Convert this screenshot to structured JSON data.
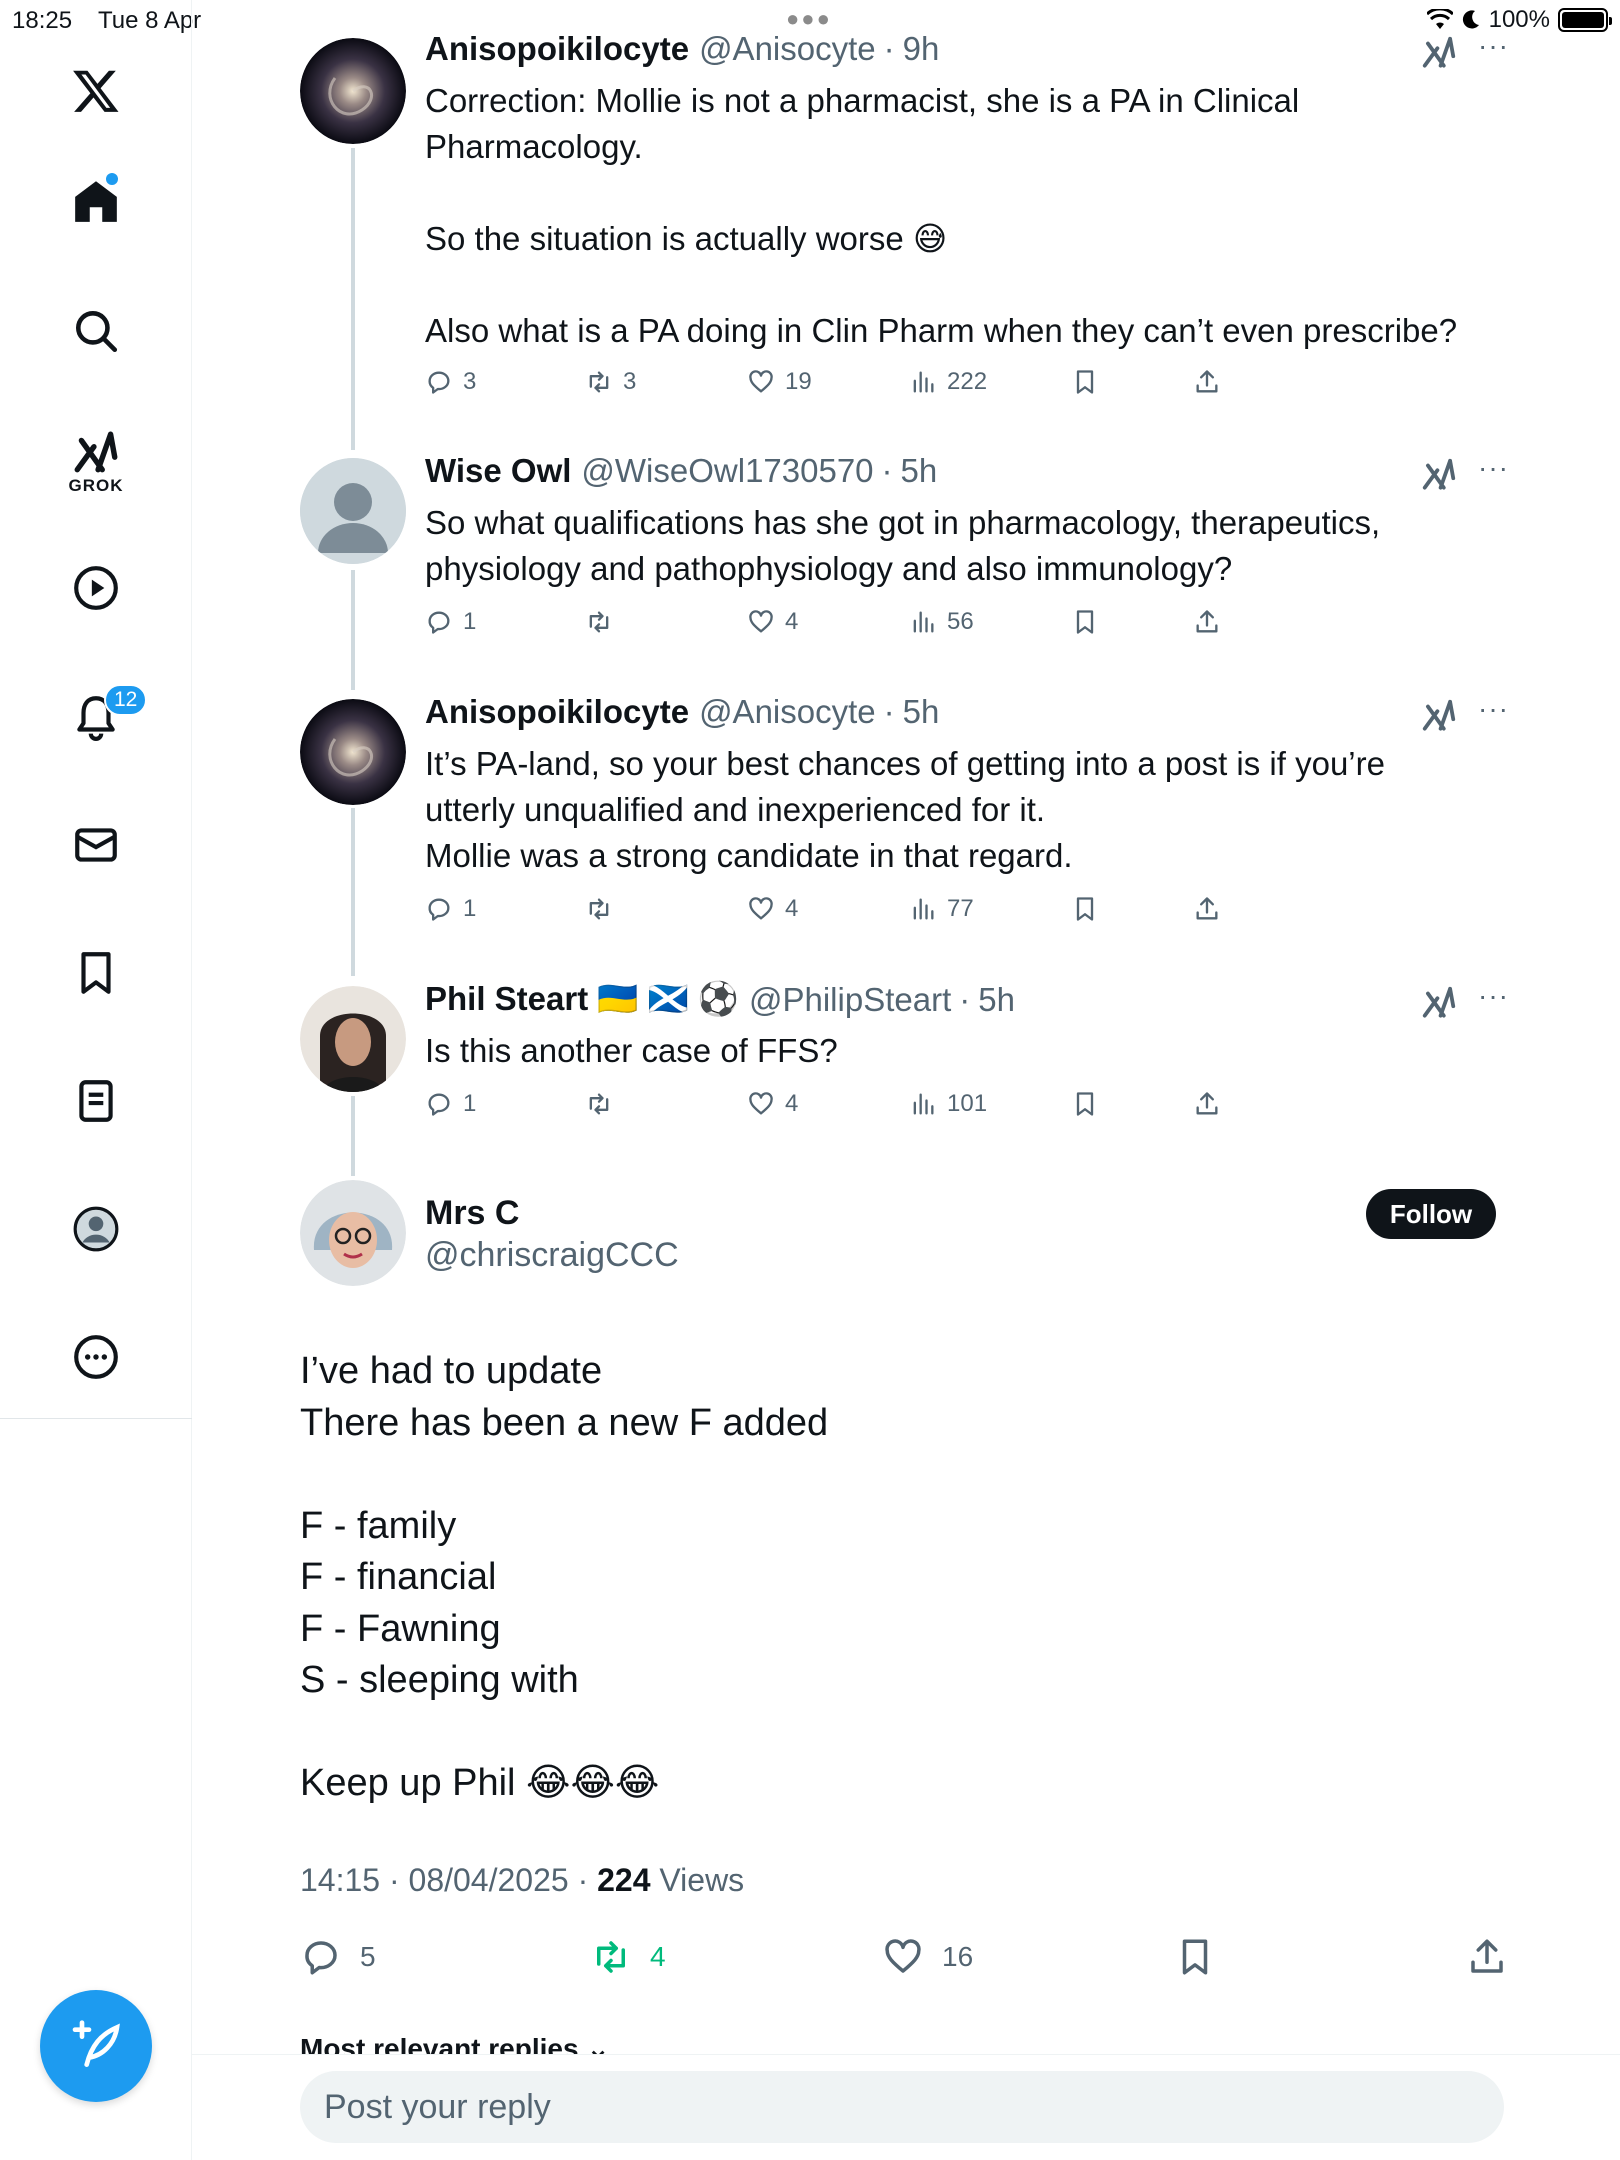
{
  "status_bar": {
    "time": "18:25",
    "date": "Tue 8 Apr",
    "battery": "100%"
  },
  "sidebar": {
    "grok_label": "GROK",
    "notifications_badge": "12",
    "items": [
      "x-logo",
      "home-icon",
      "search-icon",
      "grok-icon",
      "video-icon",
      "bell-icon",
      "mail-icon",
      "bookmark-icon",
      "list-icon",
      "profile-icon",
      "more-icon"
    ]
  },
  "replies": [
    {
      "name": "Anisopoikilocyte",
      "handle": "@Anisocyte",
      "time": "9h",
      "text": "Correction: Mollie is not a pharmacist, she is a PA in Clinical\nPharmacology.\n\nSo the situation is actually worse 😅\n\nAlso what is a PA doing in Clin Pharm when they can’t even prescribe?",
      "replies": "3",
      "reposts": "3",
      "likes": "19",
      "views": "222"
    },
    {
      "name": "Wise Owl",
      "handle": "@WiseOwl1730570",
      "time": "5h",
      "text": "So what qualifications has she got in pharmacology, therapeutics,\nphysiology and pathophysiology and also immunology?",
      "replies": "1",
      "reposts": "",
      "likes": "4",
      "views": "56"
    },
    {
      "name": "Anisopoikilocyte",
      "handle": "@Anisocyte",
      "time": "5h",
      "text": "It’s PA-land, so your best chances of getting into a post is if you’re\nutterly unqualified and inexperienced for it.\nMollie was a strong candidate in that regard.",
      "replies": "1",
      "reposts": "",
      "likes": "4",
      "views": "77"
    },
    {
      "name": "Phil Steart 🇺🇦 🏴󠁧󠁢󠁳󠁣󠁴󠁿 ⚽",
      "handle": "@PhilipSteart",
      "time": "5h",
      "text": "Is this another case of FFS?",
      "replies": "1",
      "reposts": "",
      "likes": "4",
      "views": "101"
    }
  ],
  "main_tweet": {
    "name": "Mrs C",
    "handle": "@chriscraigCCC",
    "follow_label": "Follow",
    "text": "I’ve had to update\nThere has been a new F added\n\nF - family\nF - financial\nF - Fawning\nS - sleeping with\n\nKeep up Phil 😂😂😂",
    "time": "14:15 · 08/04/2025 · ",
    "views_count": "224",
    "views_label": " Views",
    "replies": "5",
    "reposts": "4",
    "likes": "16",
    "repost_color": "#00ba7c"
  },
  "most_relevant_label": "Most relevant replies ⌄",
  "reply_bar": {
    "placeholder": "Post your reply"
  },
  "colors": {
    "accent": "#1d9bf0",
    "text": "#0f1419",
    "muted": "#536471"
  }
}
